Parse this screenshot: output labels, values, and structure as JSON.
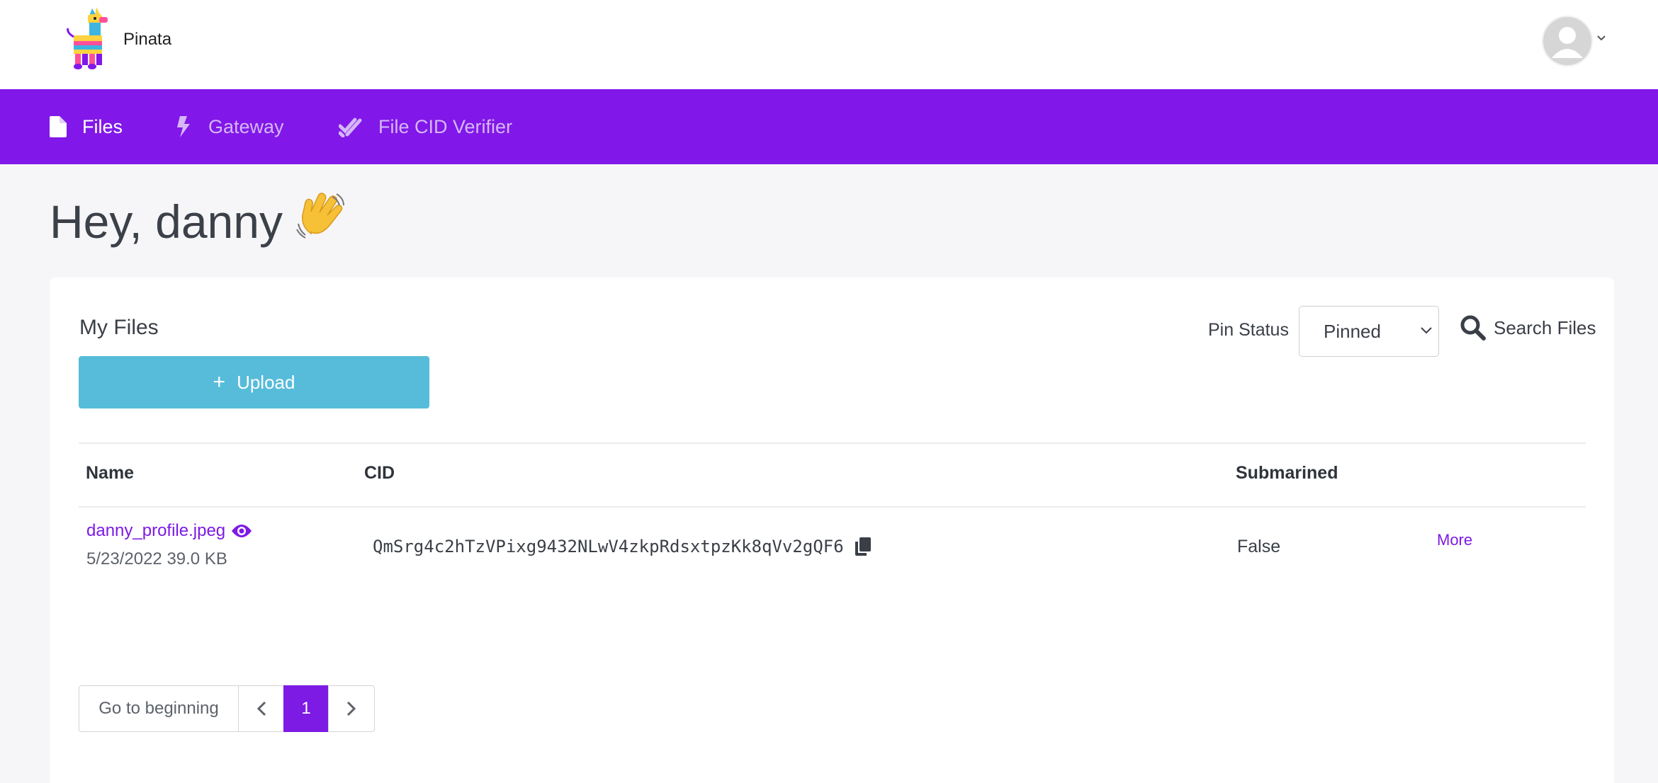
{
  "header": {
    "brand": "Pinata"
  },
  "nav": [
    {
      "label": "Files",
      "icon": "file-icon",
      "active": true
    },
    {
      "label": "Gateway",
      "icon": "bolt-icon",
      "active": false
    },
    {
      "label": "File CID Verifier",
      "icon": "check-double-icon",
      "active": false
    }
  ],
  "greeting": {
    "text": "Hey, danny",
    "emoji": "👋"
  },
  "files": {
    "title": "My Files",
    "upload_label": "Upload",
    "pin_status_label": "Pin Status",
    "pin_status_value": "Pinned",
    "search_label": "Search Files",
    "columns": {
      "name": "Name",
      "cid": "CID",
      "submarined": "Submarined"
    },
    "rows": [
      {
        "name": "danny_profile.jpeg",
        "meta": "5/23/2022 39.0 KB",
        "cid": "QmSrg4c2hTzVPixg9432NLwV4zkpRdsxtpzKk8qVv2gQF6",
        "submarined": "False",
        "more": "More"
      }
    ]
  },
  "pagination": {
    "begin_label": "Go to beginning",
    "current_page": "1"
  },
  "colors": {
    "accent": "#8117e8",
    "link": "#7d1ae4",
    "upload": "#56bcd9"
  }
}
